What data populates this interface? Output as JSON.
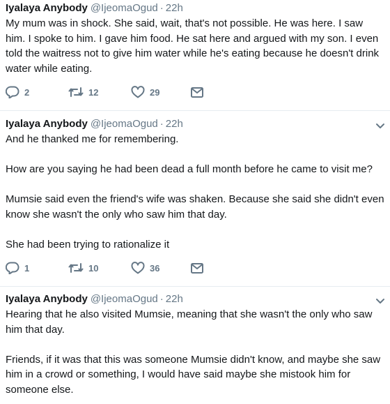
{
  "tweets": [
    {
      "author_name": "Iyalaya Anybody",
      "handle": "@IjeomaOgud",
      "separator": "·",
      "time": "22h",
      "paragraphs": [
        "My mum was in shock. She said, wait, that's not possible. He was here. I saw him. I spoke to him. I gave him food. He sat here and argued with my son. I even told the waitress not to give him water while he's eating because he doesn't drink water while eating."
      ],
      "replies": "2",
      "retweets": "12",
      "likes": "29"
    },
    {
      "author_name": "Iyalaya Anybody",
      "handle": "@IjeomaOgud",
      "separator": "·",
      "time": "22h",
      "paragraphs": [
        "And he thanked me for remembering.",
        "How are you saying he had been dead a full month before he came to visit me?",
        "Mumsie said even the friend's wife was shaken. Because she said she didn't even know she wasn't the only who saw him that day.",
        "She had been trying to rationalize it"
      ],
      "replies": "1",
      "retweets": "10",
      "likes": "36"
    },
    {
      "author_name": "Iyalaya Anybody",
      "handle": "@IjeomaOgud",
      "separator": "·",
      "time": "22h",
      "paragraphs": [
        "Hearing that he also visited Mumsie, meaning that she wasn't the only who saw him that day.",
        "Friends, if it was that this was someone Mumsie didn't know, and maybe she saw him in a crowd or something, I would have said maybe she mistook him for someone else."
      ]
    }
  ],
  "icons": {
    "reply": "reply-icon",
    "retweet": "retweet-icon",
    "like": "heart-icon",
    "dm": "envelope-icon",
    "more": "chevron-down-icon"
  },
  "colors": {
    "text": "#14171a",
    "muted": "#657786",
    "divider": "#e6ecf0"
  }
}
